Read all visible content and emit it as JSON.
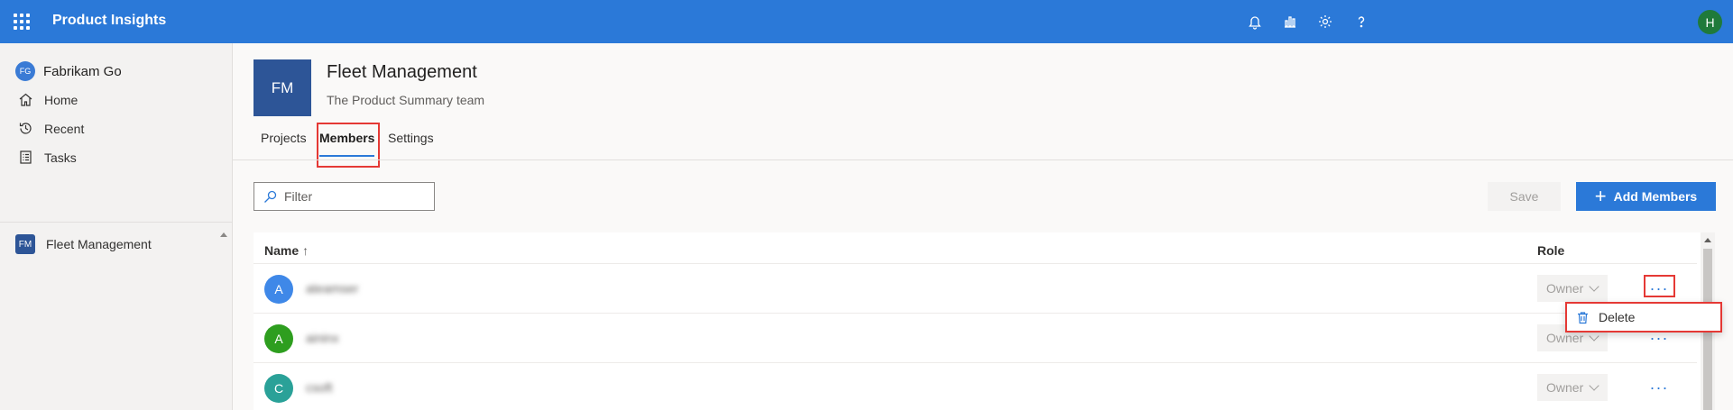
{
  "app": {
    "title": "Product Insights",
    "user_initial": "H"
  },
  "nav": {
    "org_initials": "FG",
    "org_name": "Fabrikam Go",
    "items": [
      {
        "label": "Home",
        "icon": "home-icon"
      },
      {
        "label": "Recent",
        "icon": "history-icon"
      },
      {
        "label": "Tasks",
        "icon": "tasks-icon"
      }
    ],
    "team_initials": "FM",
    "team_label": "Fleet Management"
  },
  "header": {
    "initials": "FM",
    "title": "Fleet Management",
    "subtitle": "The Product Summary team",
    "tabs": [
      {
        "label": "Projects",
        "active": false
      },
      {
        "label": "Members",
        "active": true
      },
      {
        "label": "Settings",
        "active": false
      }
    ]
  },
  "toolbar": {
    "filter_placeholder": "Filter",
    "save_label": "Save",
    "add_label": "Add Members"
  },
  "table": {
    "columns": {
      "name": "Name",
      "sort_indicator": "↑",
      "role": "Role"
    },
    "rows": [
      {
        "initial": "A",
        "name": "ateamser",
        "role": "Owner",
        "color": "#3f88e8"
      },
      {
        "initial": "A",
        "name": "aininx",
        "role": "Owner",
        "color": "#2e9e1f"
      },
      {
        "initial": "C",
        "name": "csoft",
        "role": "Owner",
        "color": "#2aa198"
      }
    ],
    "more_label": "···"
  },
  "context_menu": {
    "items": [
      {
        "label": "Delete",
        "icon": "trash-icon"
      }
    ]
  },
  "colors": {
    "accent": "#2b79d8",
    "highlight": "#e53935",
    "team_badge": "#2d5597"
  }
}
